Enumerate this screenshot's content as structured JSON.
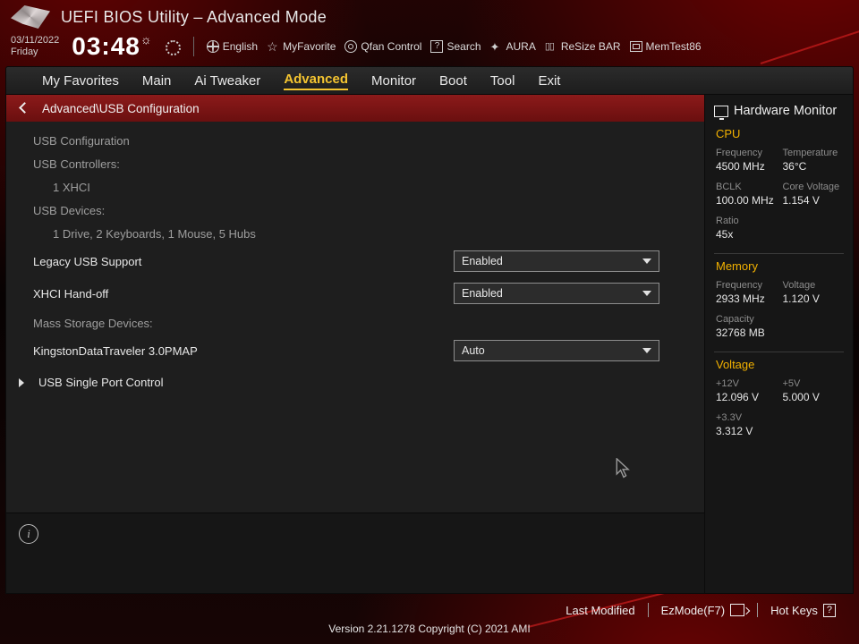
{
  "header": {
    "app_title": "UEFI BIOS Utility – Advanced Mode",
    "date": "03/11/2022",
    "day": "Friday",
    "time": "03:48",
    "tools": {
      "language": "English",
      "favorite": "MyFavorite",
      "qfan": "Qfan Control",
      "search": "Search",
      "aura": "AURA",
      "resize_bar": "ReSize BAR",
      "memtest": "MemTest86"
    }
  },
  "tabs": {
    "items": [
      "My Favorites",
      "Main",
      "Ai Tweaker",
      "Advanced",
      "Monitor",
      "Boot",
      "Tool",
      "Exit"
    ],
    "active_index": 3
  },
  "breadcrumb": "Advanced\\USB Configuration",
  "usb": {
    "section_title": "USB Configuration",
    "controllers_label": "USB Controllers:",
    "controllers_value": "1 XHCI",
    "devices_label": "USB Devices:",
    "devices_value": "1 Drive, 2 Keyboards, 1 Mouse, 5 Hubs",
    "legacy_label": "Legacy USB Support",
    "legacy_value": "Enabled",
    "xhci_label": "XHCI Hand-off",
    "xhci_value": "Enabled",
    "mass_label": "Mass Storage Devices:",
    "drive_label": "KingstonDataTraveler 3.0PMAP",
    "drive_value": "Auto",
    "single_port_label": "USB Single Port Control"
  },
  "hwmon": {
    "title": "Hardware Monitor",
    "cpu": {
      "head": "CPU",
      "freq_k": "Frequency",
      "freq_v": "4500 MHz",
      "temp_k": "Temperature",
      "temp_v": "36°C",
      "bclk_k": "BCLK",
      "bclk_v": "100.00 MHz",
      "cv_k": "Core Voltage",
      "cv_v": "1.154 V",
      "ratio_k": "Ratio",
      "ratio_v": "45x"
    },
    "mem": {
      "head": "Memory",
      "freq_k": "Frequency",
      "freq_v": "2933 MHz",
      "volt_k": "Voltage",
      "volt_v": "1.120 V",
      "cap_k": "Capacity",
      "cap_v": "32768 MB"
    },
    "volt": {
      "head": "Voltage",
      "p12_k": "+12V",
      "p12_v": "12.096 V",
      "p5_k": "+5V",
      "p5_v": "5.000 V",
      "p33_k": "+3.3V",
      "p33_v": "3.312 V"
    }
  },
  "footer": {
    "last_modified": "Last Modified",
    "ezmode": "EzMode(F7)",
    "hotkeys": "Hot Keys",
    "version": "Version 2.21.1278 Copyright (C) 2021 AMI"
  }
}
